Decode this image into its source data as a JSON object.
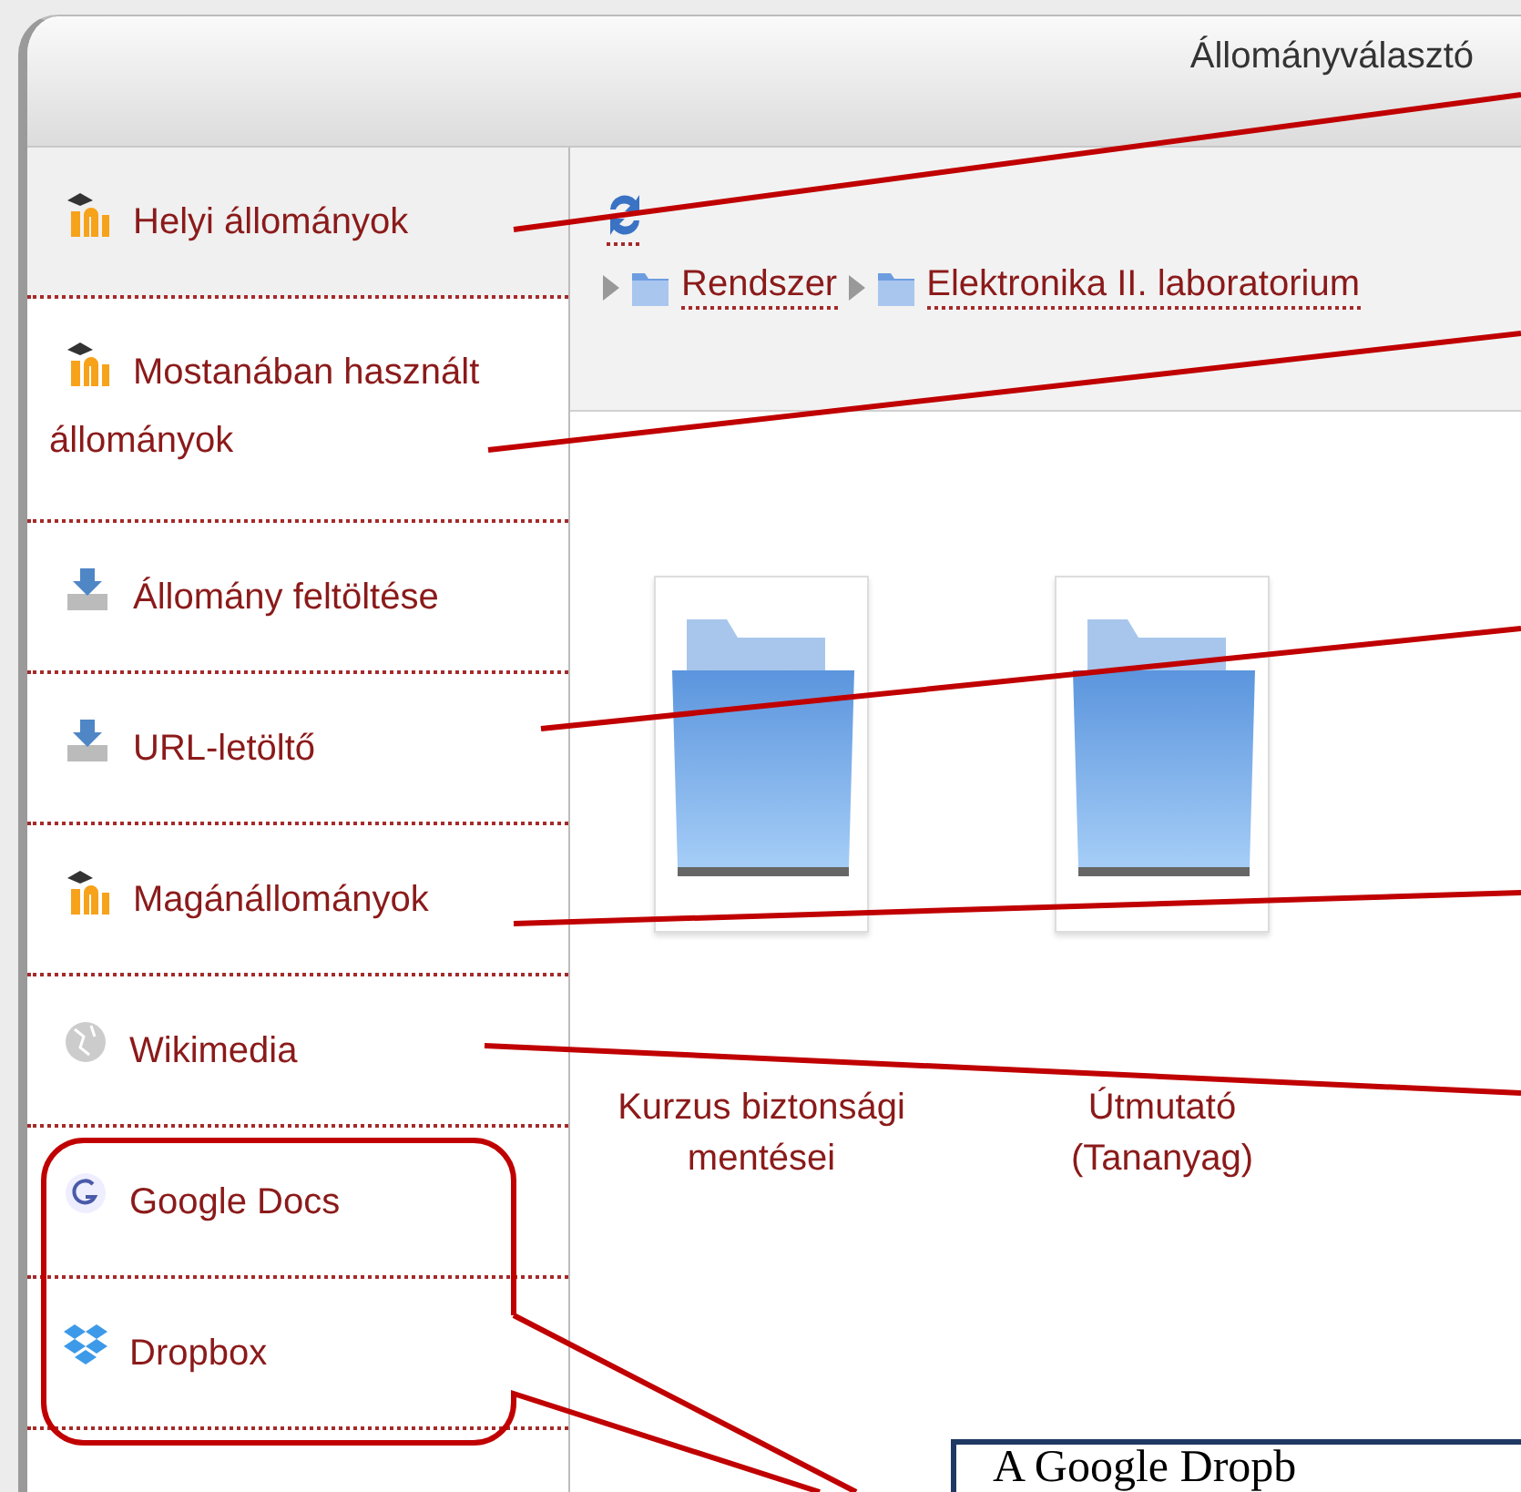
{
  "window": {
    "title": "Állományválasztó"
  },
  "sidebar": {
    "items": [
      {
        "label": "Helyi állományok",
        "kind": "moodle",
        "selected": true
      },
      {
        "label": "Mostanában használt állományok",
        "kind": "moodle",
        "selected": false
      },
      {
        "label": "Állomány feltöltése",
        "kind": "upload",
        "selected": false
      },
      {
        "label": "URL-letöltő",
        "kind": "upload",
        "selected": false
      },
      {
        "label": "Magánállományok",
        "kind": "moodle",
        "selected": false
      },
      {
        "label": "Wikimedia",
        "kind": "wikimedia",
        "selected": false
      },
      {
        "label": "Google Docs",
        "kind": "google",
        "selected": false
      },
      {
        "label": "Dropbox",
        "kind": "dropbox",
        "selected": false
      }
    ]
  },
  "breadcrumb": [
    "Rendszer",
    "Elektronika II. laboratorium"
  ],
  "folders": [
    {
      "name": "Kurzus biztonsági mentései"
    },
    {
      "name": "Útmutató (Tananyag)"
    }
  ],
  "callout": {
    "text": "A Google Dropb"
  }
}
